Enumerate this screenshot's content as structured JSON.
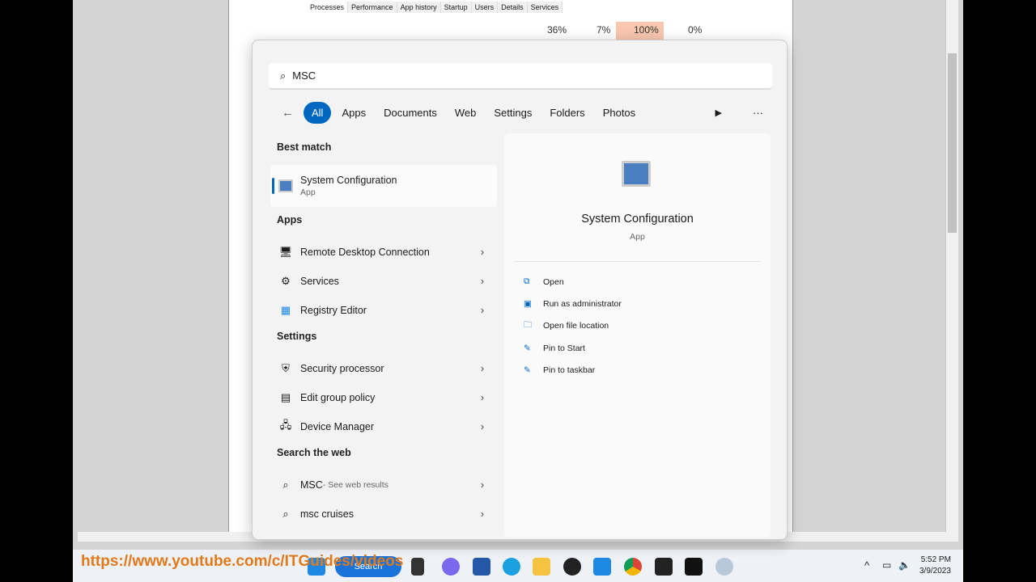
{
  "task_manager": {
    "tabs": [
      "Processes",
      "Performance",
      "App history",
      "Startup",
      "Users",
      "Details",
      "Services"
    ],
    "columns": [
      "36%",
      "7%",
      "100%",
      "0%"
    ]
  },
  "search": {
    "query": "MSC",
    "icon": "search-icon"
  },
  "filters": {
    "back": "←",
    "items": [
      "All",
      "Apps",
      "Documents",
      "Web",
      "Settings",
      "Folders",
      "Photos"
    ],
    "play": "▶",
    "more": "···"
  },
  "best_match": {
    "heading": "Best match",
    "title": "System Configuration",
    "subtitle": "App"
  },
  "apps": {
    "heading": "Apps",
    "items": [
      "Remote Desktop Connection",
      "Services",
      "Registry Editor"
    ]
  },
  "settings": {
    "heading": "Settings",
    "items": [
      "Security processor",
      "Edit group policy",
      "Device Manager"
    ]
  },
  "web": {
    "heading": "Search the web",
    "items": [
      {
        "label": "MSC",
        "suffix": " - See web results"
      },
      {
        "label": "msc cruises"
      }
    ]
  },
  "detail": {
    "title": "System Configuration",
    "subtitle": "App",
    "actions": [
      "Open",
      "Run as administrator",
      "Open file location",
      "Pin to Start",
      "Pin to taskbar"
    ]
  },
  "taskbar": {
    "search_label": "Search",
    "time": "5:52 PM",
    "date": "3/9/2023"
  },
  "watermark": "https://www.youtube.com/c/ITGuides/videos",
  "colors": {
    "accent": "#0067c0",
    "highlight": "#f9c7b0"
  }
}
